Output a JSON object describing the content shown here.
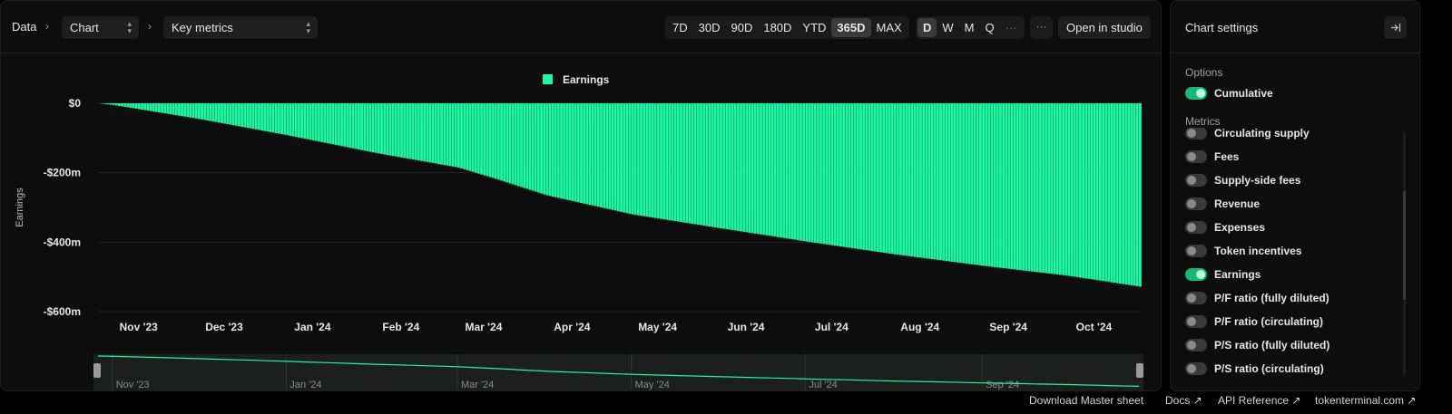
{
  "toolbar": {
    "crumb_root": "Data",
    "chart_select": "Chart",
    "metrics_select": "Key metrics",
    "ranges": [
      "7D",
      "30D",
      "90D",
      "180D",
      "YTD",
      "365D",
      "MAX"
    ],
    "active_range": "365D",
    "granularity": [
      "D",
      "W",
      "M",
      "Q",
      "···"
    ],
    "active_granularity": "D",
    "more_label": "···",
    "open_studio": "Open in studio"
  },
  "sidebar": {
    "title": "Chart settings",
    "options_label": "Options",
    "options": [
      {
        "label": "Cumulative",
        "on": true
      }
    ],
    "metrics_label": "Metrics",
    "metrics": [
      {
        "label": "Circulating supply",
        "on": false
      },
      {
        "label": "Fees",
        "on": false
      },
      {
        "label": "Supply-side fees",
        "on": false
      },
      {
        "label": "Revenue",
        "on": false
      },
      {
        "label": "Expenses",
        "on": false
      },
      {
        "label": "Token incentives",
        "on": false
      },
      {
        "label": "Earnings",
        "on": true
      },
      {
        "label": "P/F ratio (fully diluted)",
        "on": false
      },
      {
        "label": "P/F ratio (circulating)",
        "on": false
      },
      {
        "label": "P/S ratio (fully diluted)",
        "on": false
      },
      {
        "label": "P/S ratio (circulating)",
        "on": false
      }
    ]
  },
  "footer": {
    "download": "Download Master sheet",
    "docs": "Docs ↗",
    "api": "API Reference ↗",
    "site": "tokenterminal.com ↗"
  },
  "colors": {
    "accent": "#1cf7a4",
    "background": "#0d0d0d",
    "toggle_on": "#14b87a"
  },
  "chart_data": {
    "type": "bar",
    "cumulative": true,
    "series": [
      {
        "name": "Earnings",
        "color": "#1cf7a4"
      }
    ],
    "legend_position": "top-center",
    "ylabel": "Earnings",
    "yticks": [
      "$0",
      "-$200m",
      "-$400m",
      "-$600m"
    ],
    "ylim": [
      -600,
      0
    ],
    "y_unit": "millions USD",
    "xticks": [
      "Nov '23",
      "Dec '23",
      "Jan '24",
      "Feb '24",
      "Mar '24",
      "Apr '24",
      "May '24",
      "Jun '24",
      "Jul '24",
      "Aug '24",
      "Sep '24",
      "Oct '24"
    ],
    "x_range": [
      "2023-10-27",
      "2024-10-26"
    ],
    "samples": [
      {
        "x": "2023-10-27",
        "y": 0
      },
      {
        "x": "2023-11-01",
        "y": -5
      },
      {
        "x": "2023-12-01",
        "y": -45
      },
      {
        "x": "2024-01-01",
        "y": -92
      },
      {
        "x": "2024-02-01",
        "y": -143
      },
      {
        "x": "2024-03-01",
        "y": -185
      },
      {
        "x": "2024-03-15",
        "y": -220
      },
      {
        "x": "2024-04-01",
        "y": -265
      },
      {
        "x": "2024-05-01",
        "y": -320
      },
      {
        "x": "2024-06-01",
        "y": -360
      },
      {
        "x": "2024-07-01",
        "y": -398
      },
      {
        "x": "2024-08-01",
        "y": -435
      },
      {
        "x": "2024-09-01",
        "y": -468
      },
      {
        "x": "2024-10-01",
        "y": -497
      },
      {
        "x": "2024-10-26",
        "y": -528
      }
    ],
    "navigator_ticks": [
      "Nov '23",
      "Jan '24",
      "Mar '24",
      "May '24",
      "Jul '24",
      "Sep '24"
    ]
  }
}
